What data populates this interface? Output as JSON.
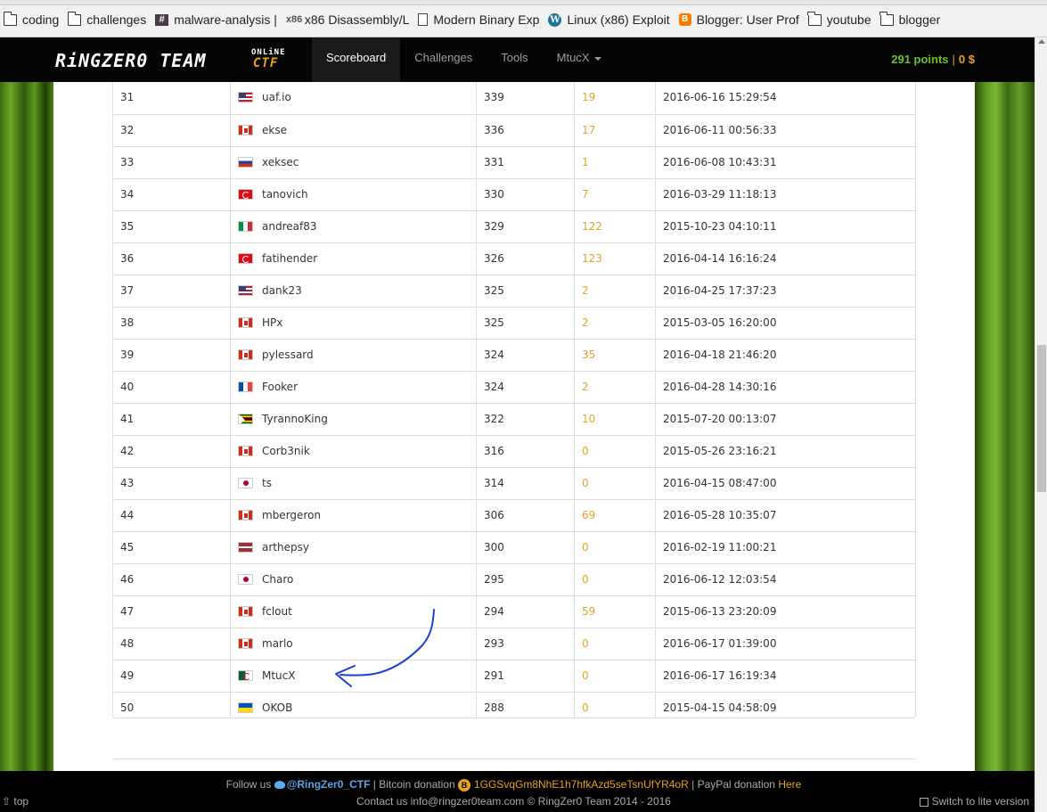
{
  "bookmarks": [
    {
      "label": "coding",
      "icon": "folder-icon"
    },
    {
      "label": "challenges",
      "icon": "folder-icon"
    },
    {
      "label": "malware-analysis |",
      "icon": "hash-icon"
    },
    {
      "label": "x86 Disassembly/L",
      "icon": "x86-icon"
    },
    {
      "label": "Modern Binary Exp",
      "icon": "page-icon"
    },
    {
      "label": "Linux (x86) Exploit",
      "icon": "wordpress-icon"
    },
    {
      "label": "Blogger: User Prof",
      "icon": "blogger-icon"
    },
    {
      "label": "youtube",
      "icon": "folder-icon"
    },
    {
      "label": "blogger",
      "icon": "folder-icon"
    }
  ],
  "nav": {
    "logo_main": "RiNGZER0 TEAM",
    "logo_online": "ONLiNE",
    "logo_ctf": "CTF",
    "items": [
      "Scoreboard",
      "Challenges",
      "Tools",
      "MtucX"
    ],
    "active": "Scoreboard",
    "points": "291 points",
    "separator": "|",
    "money": "0 $"
  },
  "scoreboard": {
    "rows": [
      {
        "rank": "31",
        "flag": "us",
        "user": "uaf.io",
        "score": "339",
        "challenges": "19",
        "date": "2016-06-16 15:29:54"
      },
      {
        "rank": "32",
        "flag": "ca",
        "user": "ekse",
        "score": "336",
        "challenges": "17",
        "date": "2016-06-11 00:56:33"
      },
      {
        "rank": "33",
        "flag": "ru",
        "user": "xeksec",
        "score": "331",
        "challenges": "1",
        "date": "2016-06-08 10:43:31"
      },
      {
        "rank": "34",
        "flag": "tr",
        "user": "tanovich",
        "score": "330",
        "challenges": "7",
        "date": "2016-03-29 11:18:13"
      },
      {
        "rank": "35",
        "flag": "it",
        "user": "andreaf83",
        "score": "329",
        "challenges": "122",
        "date": "2015-10-23 04:10:11"
      },
      {
        "rank": "36",
        "flag": "tr",
        "user": "fatihender",
        "score": "326",
        "challenges": "123",
        "date": "2016-04-14 16:16:24"
      },
      {
        "rank": "37",
        "flag": "us",
        "user": "dank23",
        "score": "325",
        "challenges": "2",
        "date": "2016-04-25 17:37:23"
      },
      {
        "rank": "38",
        "flag": "ca",
        "user": "HPx",
        "score": "325",
        "challenges": "2",
        "date": "2015-03-05 16:20:00"
      },
      {
        "rank": "39",
        "flag": "ca",
        "user": "pylessard",
        "score": "324",
        "challenges": "35",
        "date": "2016-04-18 21:46:20"
      },
      {
        "rank": "40",
        "flag": "fr",
        "user": "Fooker",
        "score": "324",
        "challenges": "2",
        "date": "2016-04-28 14:30:16"
      },
      {
        "rank": "41",
        "flag": "zw",
        "user": "TyrannoKing",
        "score": "322",
        "challenges": "10",
        "date": "2015-07-20 00:13:07"
      },
      {
        "rank": "42",
        "flag": "ca",
        "user": "Corb3nik",
        "score": "316",
        "challenges": "0",
        "date": "2015-05-26 23:16:21"
      },
      {
        "rank": "43",
        "flag": "jp",
        "user": "ts",
        "score": "314",
        "challenges": "0",
        "date": "2016-04-15 08:47:00"
      },
      {
        "rank": "44",
        "flag": "ca",
        "user": "mbergeron",
        "score": "306",
        "challenges": "69",
        "date": "2016-05-28 10:35:07"
      },
      {
        "rank": "45",
        "flag": "lv",
        "user": "arthepsy",
        "score": "300",
        "challenges": "0",
        "date": "2016-02-19 11:00:21"
      },
      {
        "rank": "46",
        "flag": "jp",
        "user": "Charo",
        "score": "295",
        "challenges": "0",
        "date": "2016-06-12 12:03:54"
      },
      {
        "rank": "47",
        "flag": "ca",
        "user": "fclout",
        "score": "294",
        "challenges": "59",
        "date": "2015-06-13 23:20:09"
      },
      {
        "rank": "48",
        "flag": "ca",
        "user": "marlo",
        "score": "293",
        "challenges": "0",
        "date": "2016-06-17 01:39:00"
      },
      {
        "rank": "49",
        "flag": "dz",
        "user": "MtucX",
        "score": "291",
        "challenges": "0",
        "date": "2016-06-17 16:19:34"
      },
      {
        "rank": "50",
        "flag": "ua",
        "user": "OKOB",
        "score": "288",
        "challenges": "0",
        "date": "2015-04-15 04:58:09"
      }
    ]
  },
  "footer": {
    "follow": "Follow us",
    "twitter": "@RingZer0_CTF",
    "sep1": "|",
    "bitcoin_label": "Bitcoin donation",
    "bitcoin_addr": "1GGSvqGm8NhE1h7hfkAzd5seTsnUfYR4oR",
    "sep2": "|",
    "paypal_label": "PayPal donation",
    "paypal_link": "Here",
    "contact": "Contact us info@ringzer0team.com © RingZer0 Team 2014 - 2016",
    "top": "top",
    "lite": "Switch to lite version"
  },
  "colors": {
    "accent_green": "#6ebf2f",
    "accent_orange": "#e8a21c",
    "challenge_count": "#e0a526",
    "annotation_blue": "#1a3fd6"
  }
}
